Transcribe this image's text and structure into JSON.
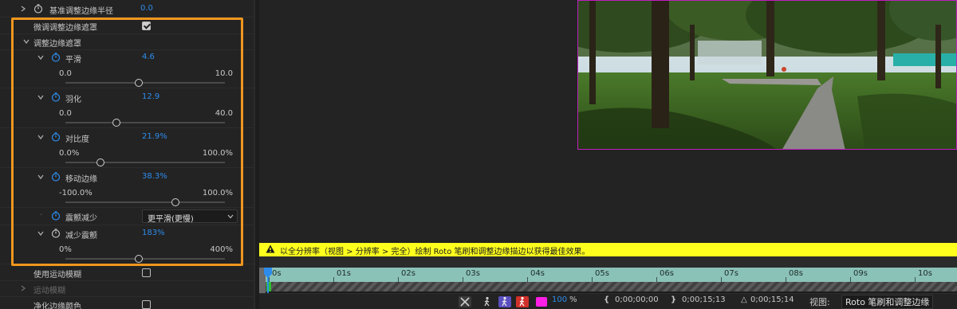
{
  "panel": {
    "rows": [
      {
        "label": "基准调整边缘半径",
        "value": "0.0"
      },
      {
        "label": "微调调整边缘遮罩"
      },
      {
        "label": "调整边缘遮罩"
      }
    ],
    "params": [
      {
        "label": "平滑",
        "value": "4.6",
        "min": "0.0",
        "max": "10.0",
        "fraction": 0.46
      },
      {
        "label": "羽化",
        "value": "12.9",
        "min": "0.0",
        "max": "40.0",
        "fraction": 0.32
      },
      {
        "label": "对比度",
        "value": "21.9%",
        "min": "0.0%",
        "max": "100.0%",
        "fraction": 0.22
      },
      {
        "label": "移动边缘",
        "value": "38.3%",
        "min": "-100.0%",
        "max": "100.0%",
        "fraction": 0.69
      },
      {
        "label": "震颤减少",
        "dropdown": "更平滑(更慢)"
      },
      {
        "label": "减少震颤",
        "value": "183%",
        "min": "0%",
        "max": "400%",
        "fraction": 0.46
      }
    ],
    "bottom_rows": [
      {
        "label": "使用运动模糊"
      },
      {
        "label": "运动模糊"
      },
      {
        "label": "净化边缘颜色"
      }
    ],
    "checkbox_refine_checked": true
  },
  "warning": "以全分辨率（视图 > 分辨率 > 完全）绘制 Roto 笔刷和调整边缘描边以获得最佳效果。",
  "timeline": {
    "ticks": [
      "0s",
      "01s",
      "02s",
      "03s",
      "04s",
      "05s",
      "06s",
      "07s",
      "08s",
      "09s",
      "10s"
    ]
  },
  "toolbar": {
    "zoom": "100",
    "zoom_unit": "%",
    "in_time": "0;00;00;00",
    "out_time": "0;00;15;13",
    "duration": "0;00;15;14",
    "duration_prefix": "△",
    "view_label": "视图:",
    "view_value": "Roto 笔刷和调整边缘"
  },
  "colors": {
    "accent_blue": "#2d8ceb",
    "highlight_orange": "#f0961e",
    "warning_yellow": "#ffff1e",
    "ruler_teal": "#8bc2b8",
    "viewer_border_magenta": "#c01ec0"
  }
}
